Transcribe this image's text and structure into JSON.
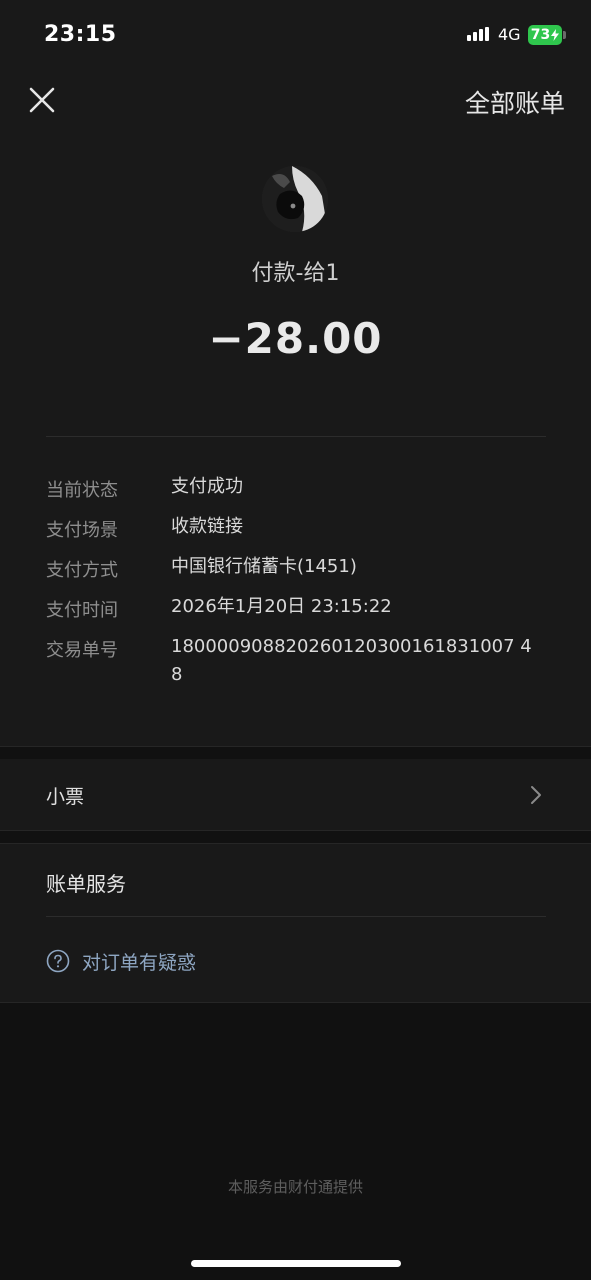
{
  "status_bar": {
    "time": "23:15",
    "network": "4G",
    "battery": "73"
  },
  "nav": {
    "all_bills_label": "全部账单",
    "close_icon": "close-icon"
  },
  "header": {
    "merchant": "付款-给1",
    "amount": "−28.00"
  },
  "details": [
    {
      "label": "当前状态",
      "value": "支付成功"
    },
    {
      "label": "支付场景",
      "value": "收款链接"
    },
    {
      "label": "支付方式",
      "value": "中国银行储蓄卡(1451)"
    },
    {
      "label": "支付时间",
      "value": "2026年1月20日 23:15:22"
    },
    {
      "label": "交易单号",
      "value": "180000908820260120300161831007 4\n8"
    }
  ],
  "receipt": {
    "label": "小票",
    "icon": "chevron-right-icon"
  },
  "service": {
    "title": "账单服务",
    "doubt_label": "对订单有疑惑",
    "doubt_icon": "question-circle-icon"
  },
  "footer": {
    "text": "本服务由财付通提供"
  },
  "colors": {
    "background": "#191919",
    "link": "#8ea6c2",
    "battery": "#2fc64d"
  }
}
